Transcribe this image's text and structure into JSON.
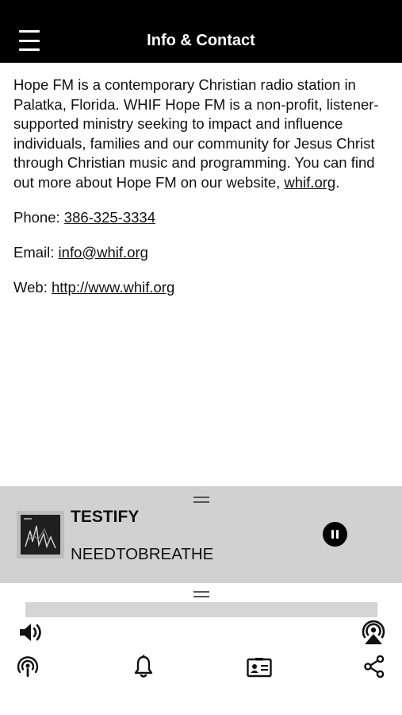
{
  "header": {
    "title": "Info & Contact"
  },
  "info": {
    "description_text": "Hope FM is a contemporary Christian radio station in Palatka, Florida. WHIF Hope FM is a non-profit, listener-supported ministry seeking to impact and influence individuals, families and our community for Jesus Christ through Christian music and programming. You can find out more about Hope FM on our website, ",
    "website_link": "whif.org",
    "description_end": ".",
    "phone_label": "Phone: ",
    "phone_value": "386-325-3334",
    "email_label": "Email: ",
    "email_value": "info@whif.org",
    "web_label": "Web: ",
    "web_value": "http://www.whif.org"
  },
  "now_playing": {
    "title": "TESTIFY",
    "artist": "NEEDTOBREATHE",
    "state": "playing"
  },
  "icons": {
    "menu": "hamburger-menu-icon",
    "pause": "pause-icon",
    "volume": "speaker-icon",
    "airplay": "airplay-icon",
    "podcast": "podcast-icon",
    "alerts": "bell-icon",
    "contact": "contact-card-icon",
    "share": "share-icon"
  },
  "colors": {
    "header_bg": "#000000",
    "player_bg": "#d1d1d1",
    "volume_track": "#d4d4d4"
  }
}
